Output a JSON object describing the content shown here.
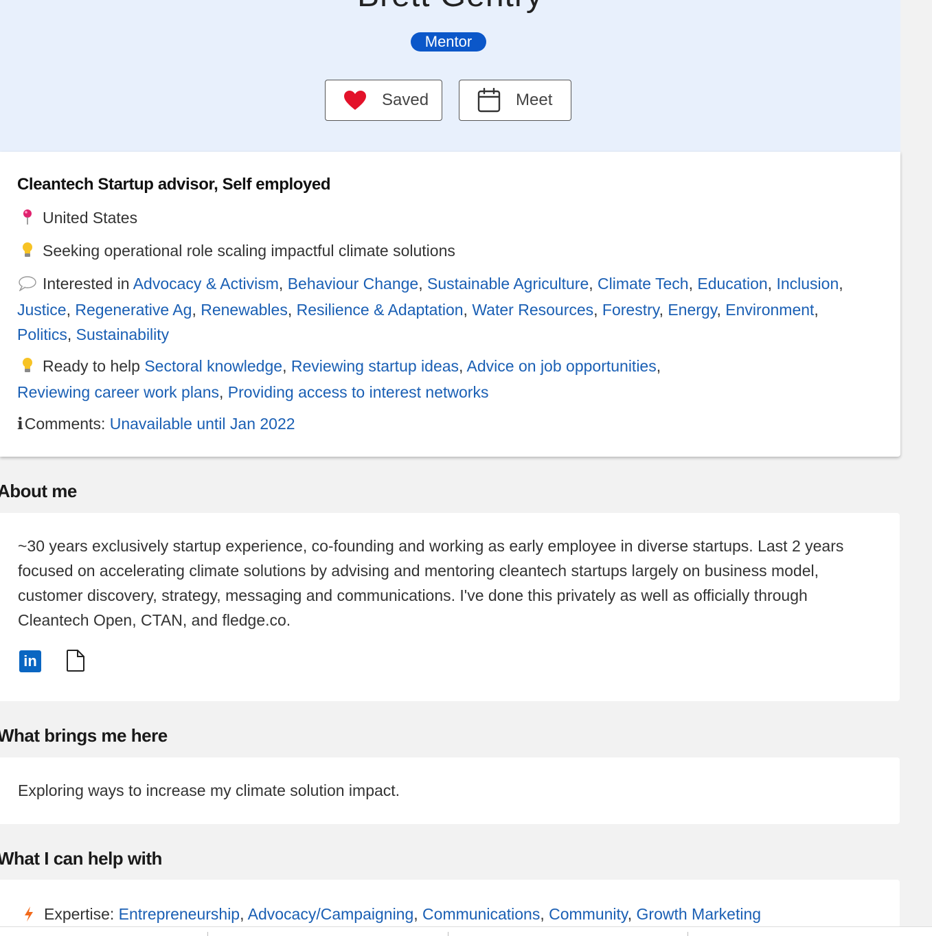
{
  "profile": {
    "name": "Brett Gentry",
    "role_badge": "Mentor",
    "buttons": {
      "saved_label": "Saved",
      "meet_label": "Meet"
    }
  },
  "details": {
    "title": "Cleantech Startup advisor, Self employed",
    "location": "United States",
    "seeking": "Seeking operational role scaling impactful climate solutions",
    "interests_prefix": "Interested in",
    "interests": [
      "Advocacy & Activism",
      "Behaviour Change",
      "Sustainable Agriculture",
      "Climate Tech",
      "Education",
      "Inclusion",
      "Justice",
      "Regenerative Ag",
      "Renewables",
      "Resilience & Adaptation",
      "Water Resources",
      "Forestry",
      "Energy",
      "Environment",
      "Politics",
      "Sustainability"
    ],
    "help_prefix": "Ready to help",
    "help_items": [
      "Sectoral knowledge",
      "Reviewing startup ideas",
      "Advice on job opportunities",
      "Reviewing career work plans",
      "Providing access to interest networks"
    ],
    "comments_label": "Comments:",
    "comments_value": "Unavailable until Jan 2022"
  },
  "about": {
    "heading": "About me",
    "text": "~30 years exclusively startup experience, co-founding and working as early employee in diverse startups. Last 2 years focused on accelerating climate solutions by advising and mentoring cleantech startups largely on business model, customer discovery, strategy, messaging and communications. I've done this privately as well as officially through Cleantech Open, CTAN, and fledge.co.",
    "linkedin_label": "in"
  },
  "brings": {
    "heading": "What brings me here",
    "text": "Exploring ways to increase my climate solution impact."
  },
  "help": {
    "heading": "What I can help with",
    "expertise_label": "Expertise:",
    "expertise": [
      "Entrepreneurship",
      "Advocacy/Campaigning",
      "Communications",
      "Community",
      "Growth Marketing"
    ]
  },
  "icons": {
    "location": "pin-icon",
    "seeking": "lightbulb-icon",
    "interests": "speech-bubble-icon",
    "help": "lightbulb-icon",
    "comments": "info-icon",
    "expertise": "lightning-icon",
    "saved": "heart-icon",
    "meet": "calendar-icon",
    "linkedin": "linkedin-icon",
    "document": "document-icon"
  },
  "colors": {
    "badge": "#0b57c9",
    "link": "#1a5fb4",
    "header_bg": "#e8f0fc",
    "heart": "#e3122a",
    "linkedin": "#0a66c2"
  }
}
